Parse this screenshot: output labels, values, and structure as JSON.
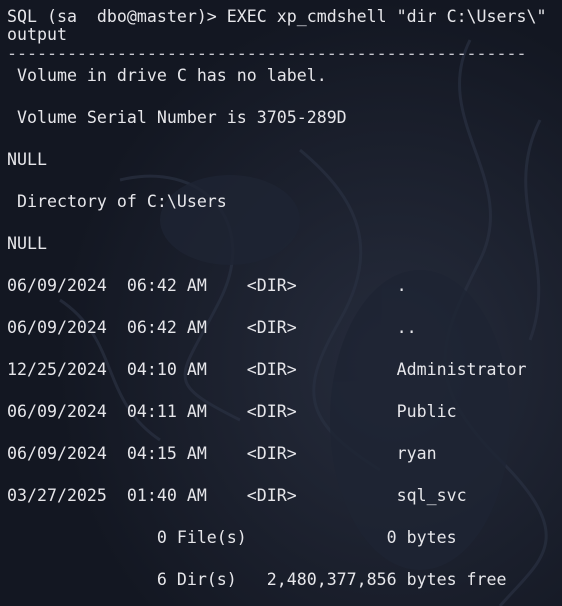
{
  "terminal": {
    "prompt_line": "SQL (sa  dbo@master)> EXEC xp_cmdshell \"dir C:\\Users\\\"",
    "column_header": "output",
    "separator": "----------------------------------------------------",
    "output_lines": [
      " Volume in drive C has no label.",
      " Volume Serial Number is 3705-289D",
      "NULL",
      " Directory of C:\\Users",
      "NULL",
      "06/09/2024  06:42 AM    <DIR>          .",
      "06/09/2024  06:42 AM    <DIR>          ..",
      "12/25/2024  04:10 AM    <DIR>          Administrator",
      "06/09/2024  04:11 AM    <DIR>          Public",
      "06/09/2024  04:15 AM    <DIR>          ryan",
      "03/27/2025  01:40 AM    <DIR>          sql_svc",
      "               0 File(s)              0 bytes",
      "               6 Dir(s)   2,480,377,856 bytes free"
    ]
  },
  "colors": {
    "background": "#161a26",
    "text": "#e6e6ea"
  }
}
